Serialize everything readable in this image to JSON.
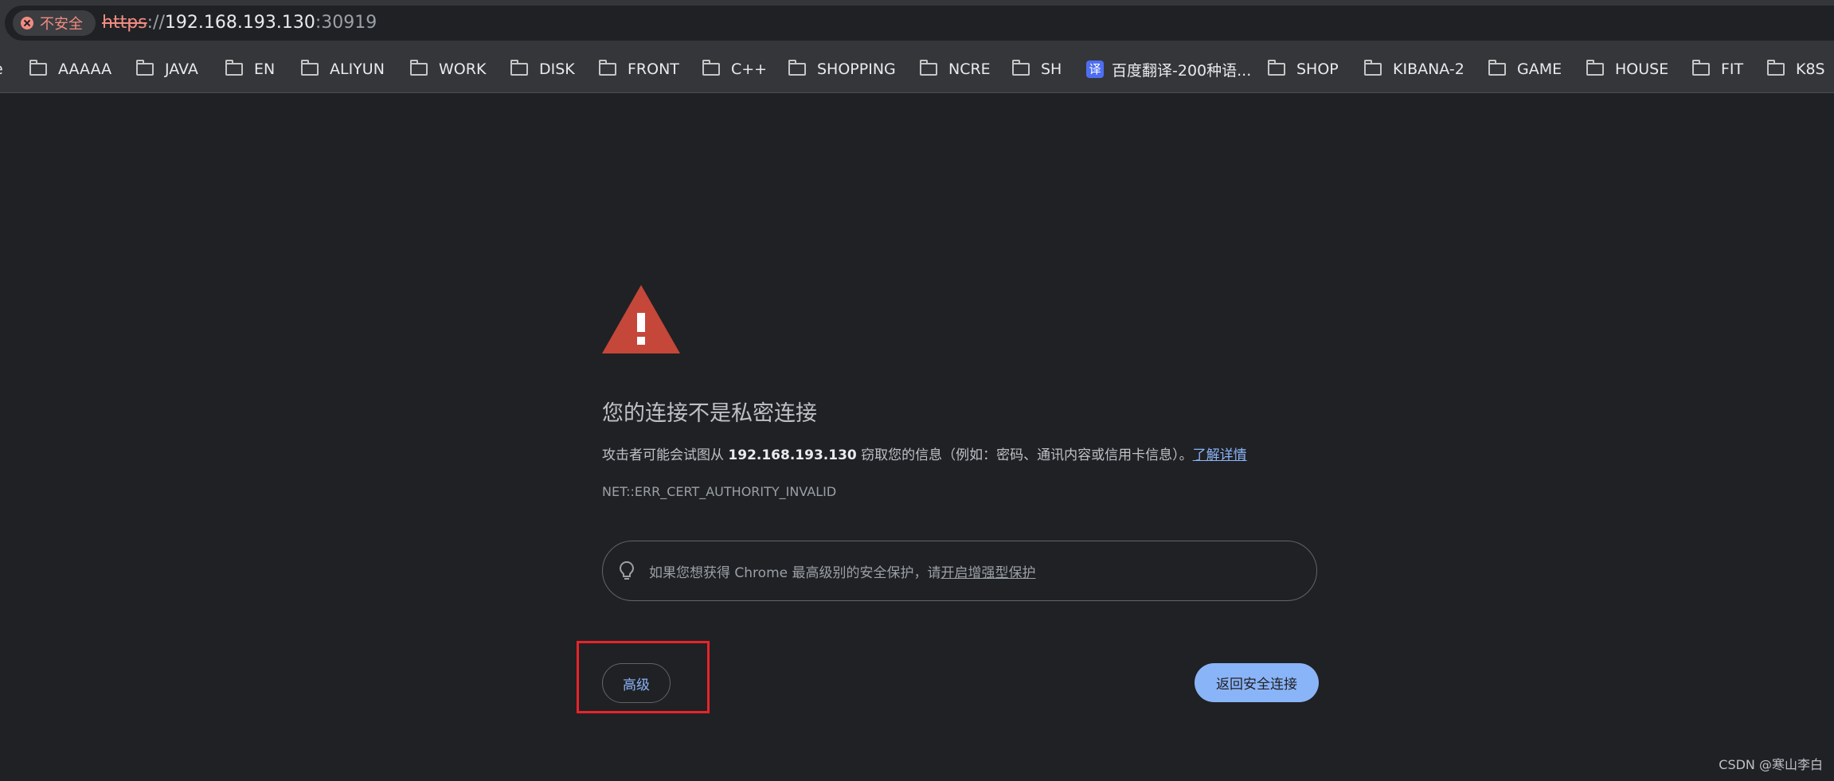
{
  "browser": {
    "security_chip": {
      "icon": "error-circle-icon",
      "label": "不安全",
      "color": "#f28b82"
    },
    "url": {
      "scheme": "https",
      "separator": "://",
      "host": "192.168.193.130",
      "port": ":30919"
    }
  },
  "bookmarks": {
    "partial_item": "e",
    "items": [
      {
        "label": "AAAAA",
        "icon": "folder-icon"
      },
      {
        "label": "JAVA",
        "icon": "folder-icon"
      },
      {
        "label": "EN",
        "icon": "folder-icon"
      },
      {
        "label": "ALIYUN",
        "icon": "folder-icon"
      },
      {
        "label": "WORK",
        "icon": "folder-icon"
      },
      {
        "label": "DISK",
        "icon": "folder-icon"
      },
      {
        "label": "FRONT",
        "icon": "folder-icon"
      },
      {
        "label": "C++",
        "icon": "folder-icon"
      },
      {
        "label": "SHOPPING",
        "icon": "folder-icon"
      },
      {
        "label": "NCRE",
        "icon": "folder-icon"
      },
      {
        "label": "SH",
        "icon": "folder-icon"
      },
      {
        "label": "百度翻译-200种语...",
        "icon": "translate-icon",
        "icon_text": "译"
      },
      {
        "label": "SHOP",
        "icon": "folder-icon"
      },
      {
        "label": "KIBANA-2",
        "icon": "folder-icon"
      },
      {
        "label": "GAME",
        "icon": "folder-icon"
      },
      {
        "label": "HOUSE",
        "icon": "folder-icon"
      },
      {
        "label": "FIT",
        "icon": "folder-icon"
      },
      {
        "label": "K8S",
        "icon": "folder-icon"
      }
    ]
  },
  "interstitial": {
    "warning_icon": "warning-triangle-icon",
    "warning_color": "#c5473a",
    "heading": "您的连接不是私密连接",
    "explanation": {
      "prefix": "攻击者可能会试图从 ",
      "host": "192.168.193.130",
      "suffix": " 窃取您的信息（例如：密码、通讯内容或信用卡信息）。",
      "learn_more": "了解详情"
    },
    "error_code": "NET::ERR_CERT_AUTHORITY_INVALID",
    "enhanced_protection": {
      "icon": "lightbulb-icon",
      "text": "如果您想获得 Chrome 最高级别的安全保护，请",
      "link": "开启增强型保护"
    },
    "advanced_button": "高级",
    "back_button": "返回安全连接",
    "highlight_color": "#e8242a"
  },
  "watermark": "CSDN @寒山李白"
}
